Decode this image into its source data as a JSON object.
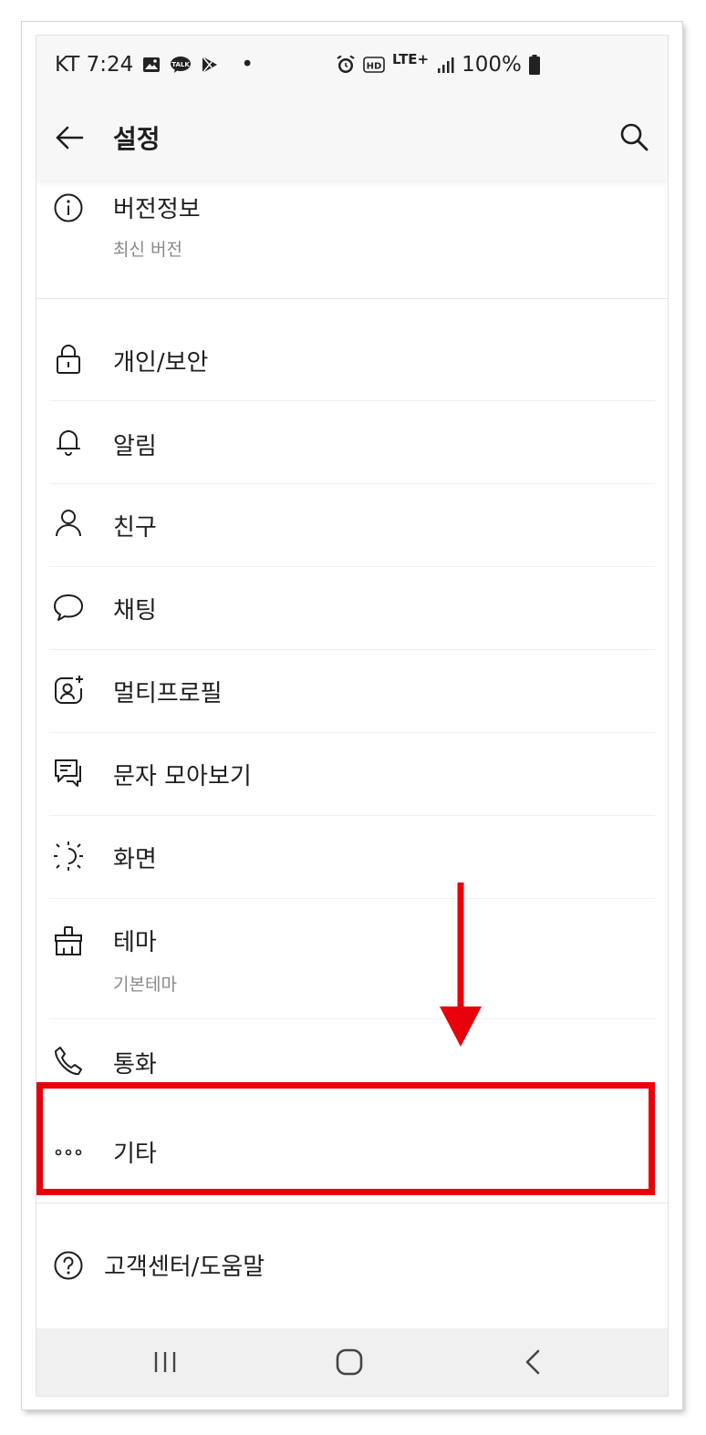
{
  "status_bar": {
    "carrier_time": "KT 7:24",
    "dot": "•",
    "network": "LTE+",
    "battery": "100%",
    "left_icons": [
      "image-icon",
      "talk-icon",
      "play-store-icon"
    ],
    "right_icons": [
      "alarm-icon",
      "hd-icon",
      "signal-icon",
      "battery-icon"
    ]
  },
  "app_bar": {
    "title": "설정",
    "back_icon": "arrow-left-icon",
    "search_icon": "search-icon"
  },
  "version": {
    "label": "버전정보",
    "sub": "최신 버전",
    "icon": "info-icon"
  },
  "menu": [
    {
      "label": "개인/보안",
      "icon": "lock-icon"
    },
    {
      "label": "알림",
      "icon": "bell-icon"
    },
    {
      "label": "친구",
      "icon": "person-icon"
    },
    {
      "label": "채팅",
      "icon": "chat-bubble-icon"
    },
    {
      "label": "멀티프로필",
      "icon": "multi-profile-icon"
    },
    {
      "label": "문자 모아보기",
      "icon": "message-icon"
    },
    {
      "label": "화면",
      "icon": "brightness-icon"
    },
    {
      "label": "테마",
      "sub": "기본테마",
      "icon": "brush-icon"
    },
    {
      "label": "통화",
      "icon": "phone-icon"
    },
    {
      "label": "기타",
      "icon": "more-dots-icon"
    }
  ],
  "help": {
    "label": "고객센터/도움말",
    "icon": "question-icon"
  },
  "annotation": {
    "color": "#e8000b",
    "highlighted_item": "기타"
  },
  "nav_bar": {
    "icons": [
      "recent-apps-icon",
      "home-icon",
      "back-nav-icon"
    ]
  }
}
